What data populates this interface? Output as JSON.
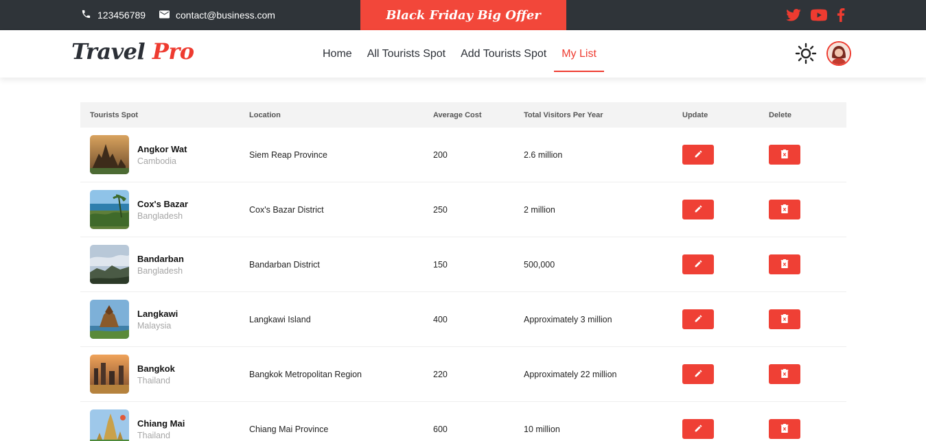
{
  "topbar": {
    "phone": "123456789",
    "email": "contact@business.com",
    "offer": "Black Friday Big Offer",
    "phone_icon": "phone-icon",
    "email_icon": "envelope-icon",
    "socials": [
      "twitter-icon",
      "youtube-icon",
      "facebook-icon"
    ]
  },
  "navbar": {
    "logo_part1": "Travel",
    "logo_part2": "Pro",
    "links": [
      "Home",
      "All Tourists Spot",
      "Add Tourists Spot",
      "My List"
    ],
    "active_link": "My List",
    "theme_icon": "sun-icon",
    "avatar_icon": "user-avatar"
  },
  "table": {
    "headers": [
      "Tourists Spot",
      "Location",
      "Average Cost",
      "Total Visitors Per Year",
      "Update",
      "Delete"
    ],
    "rows": [
      {
        "name": "Angkor Wat",
        "country": "Cambodia",
        "location": "Siem Reap Province",
        "cost": "200",
        "visitors": "2.6 million"
      },
      {
        "name": "Cox's Bazar",
        "country": "Bangladesh",
        "location": "Cox's Bazar District",
        "cost": "250",
        "visitors": "2 million"
      },
      {
        "name": "Bandarban",
        "country": "Bangladesh",
        "location": "Bandarban District",
        "cost": "150",
        "visitors": "500,000"
      },
      {
        "name": "Langkawi",
        "country": "Malaysia",
        "location": "Langkawi Island",
        "cost": "400",
        "visitors": "Approximately 3 million"
      },
      {
        "name": "Bangkok",
        "country": "Thailand",
        "location": "Bangkok Metropolitan Region",
        "cost": "220",
        "visitors": "Approximately 22 million"
      },
      {
        "name": "Chiang Mai",
        "country": "Thailand",
        "location": "Chiang Mai Province",
        "cost": "600",
        "visitors": "10 million"
      }
    ]
  },
  "colors": {
    "accent": "#ef4035",
    "topbar_bg": "#2f3439",
    "header_bg": "#f3f3f3"
  }
}
